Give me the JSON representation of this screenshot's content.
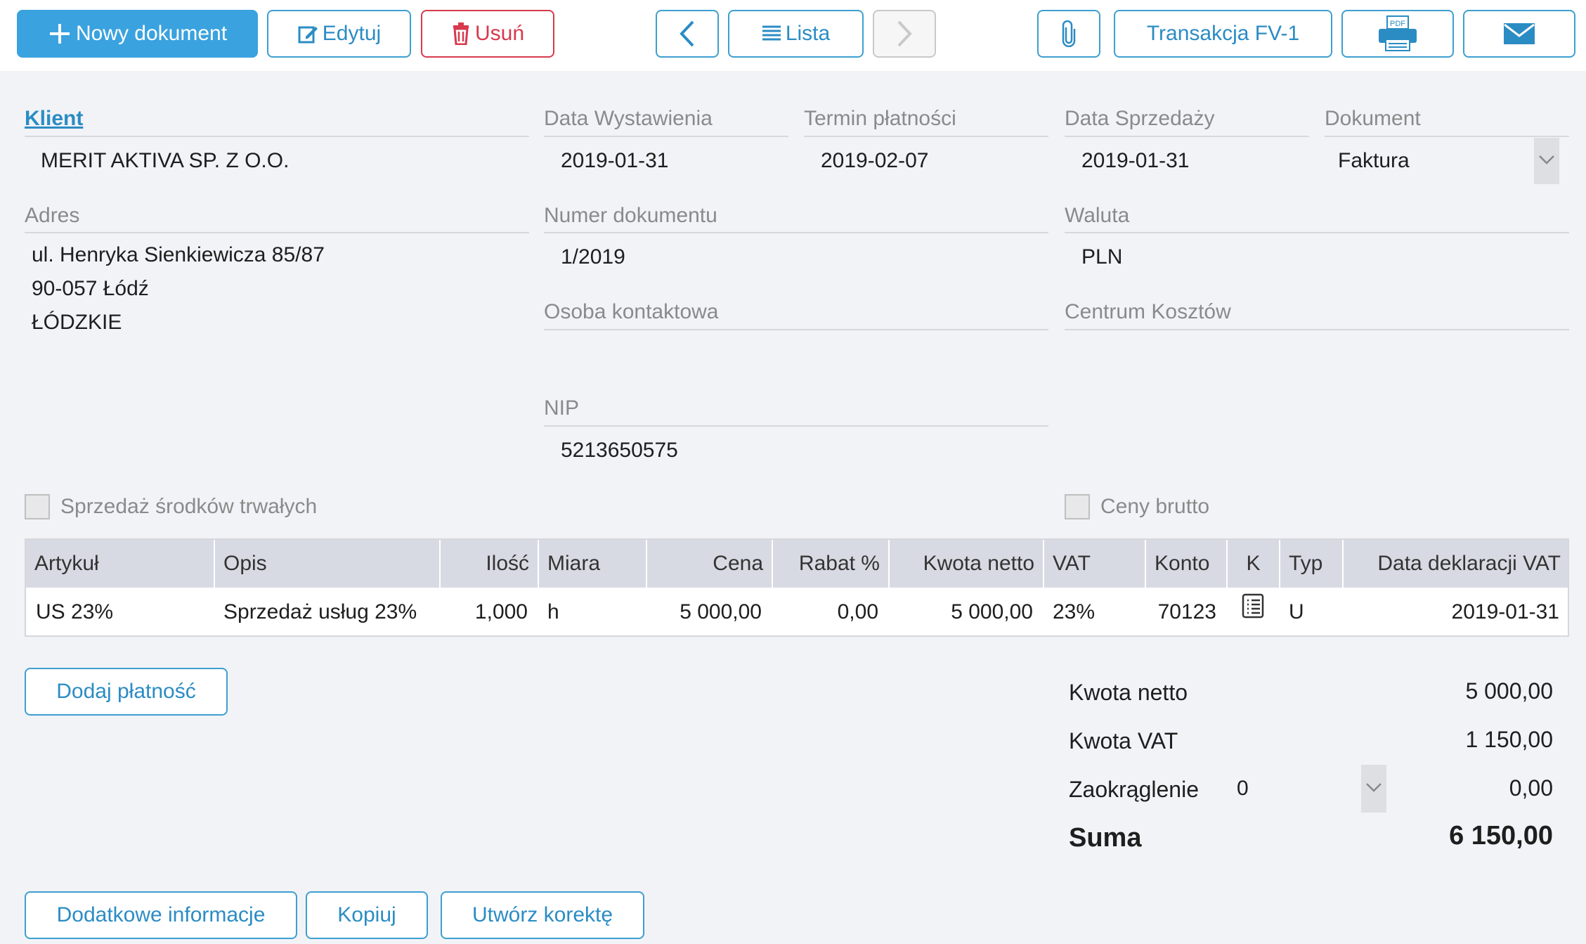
{
  "toolbar": {
    "new_document": "Nowy dokument",
    "edit": "Edytuj",
    "delete": "Usuń",
    "list": "Lista",
    "transaction": "Transakcja FV-1"
  },
  "client": {
    "label": "Klient",
    "value": "MERIT AKTIVA SP. Z O.O."
  },
  "address": {
    "label": "Adres",
    "line1": "ul. Henryka Sienkiewicza 85/87",
    "line2": "90-057 Łódź",
    "line3": "ŁÓDZKIE"
  },
  "issue_date": {
    "label": "Data Wystawienia",
    "value": "2019-01-31"
  },
  "payment_due": {
    "label": "Termin płatności",
    "value": "2019-02-07"
  },
  "sale_date": {
    "label": "Data Sprzedaży",
    "value": "2019-01-31"
  },
  "document_type": {
    "label": "Dokument",
    "value": "Faktura"
  },
  "doc_number": {
    "label": "Numer dokumentu",
    "value": "1/2019"
  },
  "currency": {
    "label": "Waluta",
    "value": "PLN"
  },
  "contact_person": {
    "label": "Osoba kontaktowa",
    "value": ""
  },
  "cost_center": {
    "label": "Centrum Kosztów",
    "value": ""
  },
  "nip": {
    "label": "NIP",
    "value": "5213650575"
  },
  "checkboxes": {
    "fixed_assets": "Sprzedaż środków trwałych",
    "gross_prices": "Ceny brutto"
  },
  "table": {
    "headers": [
      "Artykuł",
      "Opis",
      "Ilość",
      "Miara",
      "Cena",
      "Rabat %",
      "Kwota netto",
      "VAT",
      "Konto",
      "K",
      "Typ",
      "Data deklaracji VAT"
    ],
    "rows": [
      [
        "US 23%",
        "Sprzedaż usług 23%",
        "1,000",
        "h",
        "5 000,00",
        "0,00",
        "5 000,00",
        "23%",
        "70123",
        "",
        "U",
        "2019-01-31"
      ]
    ]
  },
  "add_payment": "Dodaj płatność",
  "totals": {
    "net_label": "Kwota netto",
    "net_value": "5 000,00",
    "vat_label": "Kwota VAT",
    "vat_value": "1 150,00",
    "rounding_label": "Zaokrąglenie",
    "rounding_select": "0",
    "rounding_value": "0,00",
    "sum_label": "Suma",
    "sum_value": "6 150,00"
  },
  "footer": {
    "more_info": "Dodatkowe informacje",
    "copy": "Kopiuj",
    "correction": "Utwórz korektę"
  },
  "icons": [
    "plus-icon",
    "pencil-icon",
    "trash-icon",
    "chevron-left-icon",
    "list-icon",
    "chevron-right-icon",
    "paperclip-icon",
    "pdf-printer-icon",
    "envelope-icon",
    "chevron-down-icon",
    "document-list-icon"
  ],
  "colors": {
    "accent": "#3aa2df",
    "danger": "#d8394c",
    "header_bg": "#d8dae3"
  }
}
